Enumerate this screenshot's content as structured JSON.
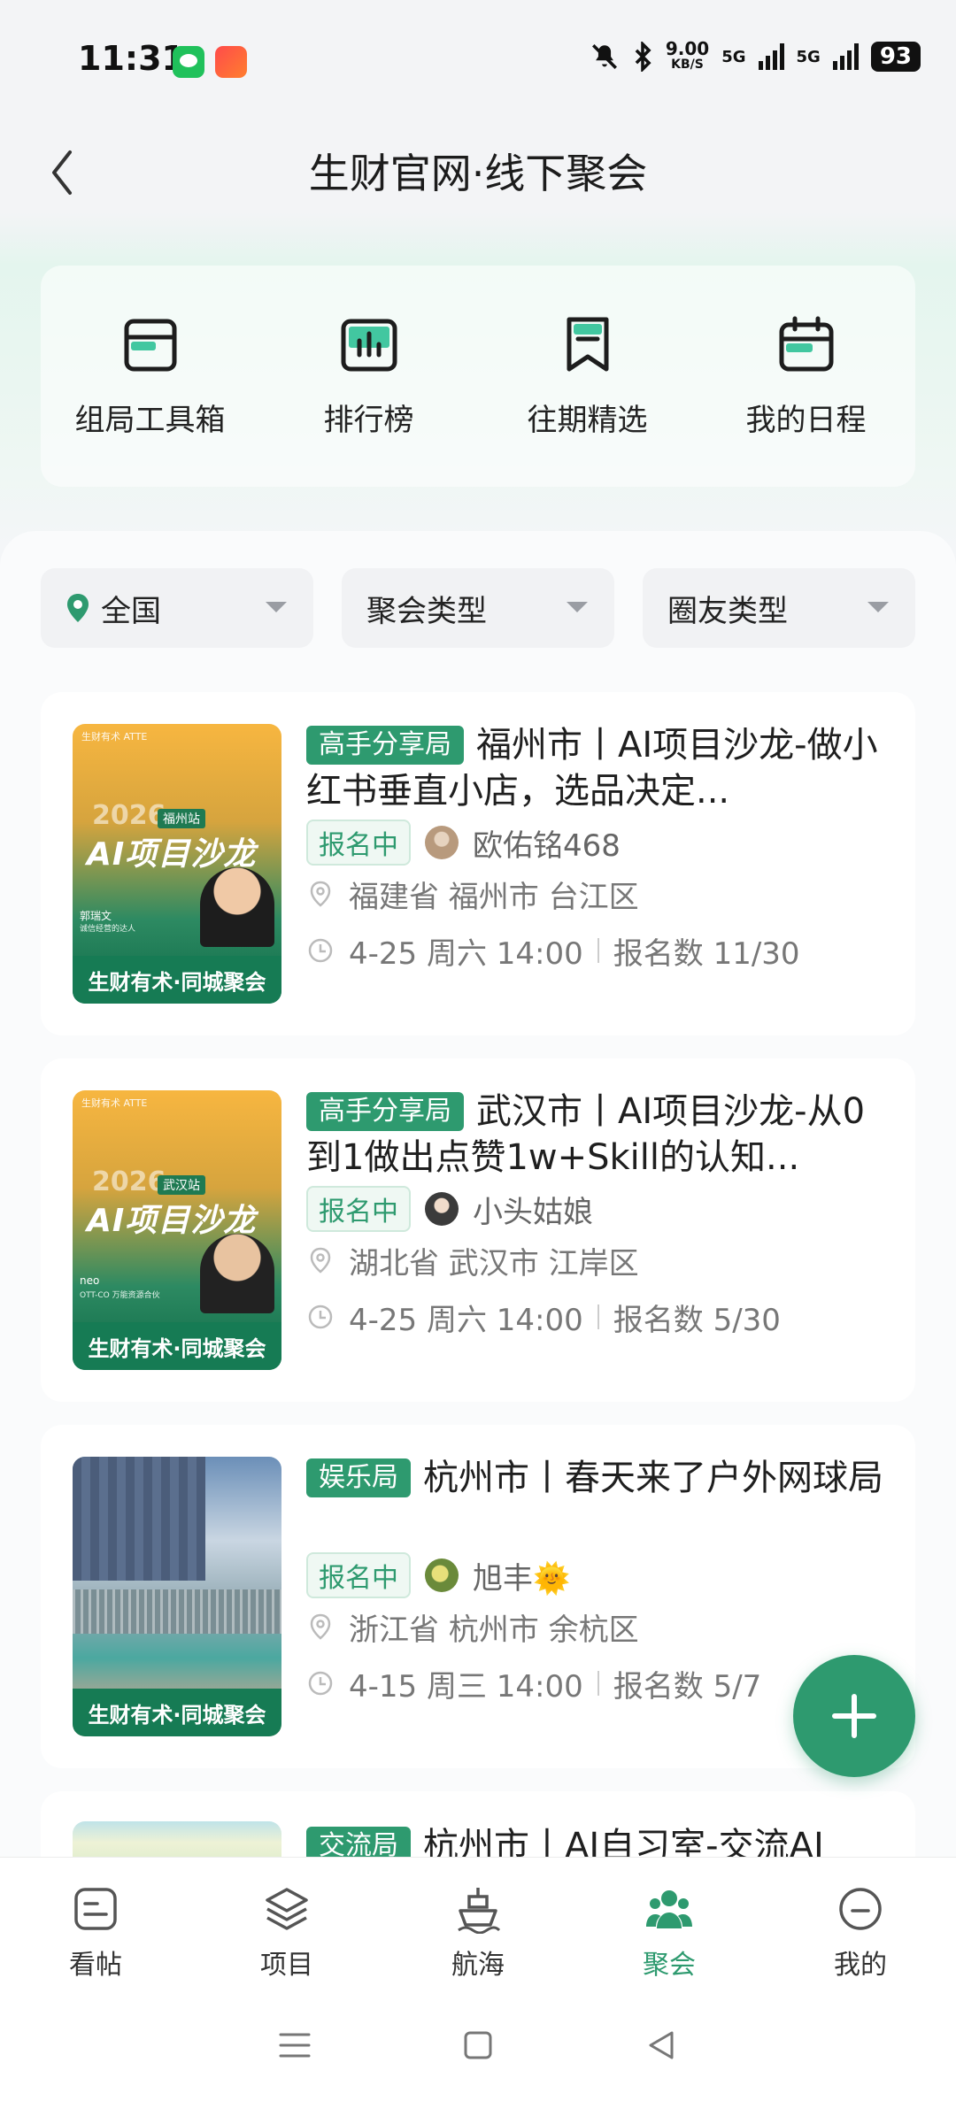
{
  "status_bar": {
    "time": "11:31",
    "net_speed_top": "9.00",
    "net_speed_bottom": "KB/S",
    "network_1": "5G",
    "network_2": "5G",
    "battery": "93"
  },
  "header": {
    "title": "生财官网·线下聚会"
  },
  "tools": [
    {
      "label": "组局工具箱",
      "icon": "toolbox-icon"
    },
    {
      "label": "排行榜",
      "icon": "ranking-icon"
    },
    {
      "label": "往期精选",
      "icon": "bookmark-icon"
    },
    {
      "label": "我的日程",
      "icon": "calendar-icon"
    }
  ],
  "filters": {
    "region": "全国",
    "meetup_type": "聚会类型",
    "member_type": "圈友类型"
  },
  "events": [
    {
      "tag": "高手分享局",
      "title": "福州市丨AI项目沙龙-做小红书垂直小店，选品决定...",
      "status": "报名中",
      "host": "欧佑铭468",
      "location": "福建省 福州市 台江区",
      "time": "4-25 周六 14:00",
      "signups": "报名数 11/30",
      "cover": {
        "brand": "生财有术 ATTE",
        "year": "2026",
        "station": "福州站",
        "headline": "AI项目沙龙",
        "speaker": "郭瑞文",
        "speaker_sub": "诚信经营的达人",
        "footer": "生财有术·同城聚会"
      }
    },
    {
      "tag": "高手分享局",
      "title": "武汉市丨AI项目沙龙-从0到1做出点赞1w+Skill的认知...",
      "status": "报名中",
      "host": "小头姑娘",
      "location": "湖北省 武汉市 江岸区",
      "time": "4-25 周六 14:00",
      "signups": "报名数 5/30",
      "cover": {
        "brand": "生财有术 ATTE",
        "year": "2026",
        "station": "武汉站",
        "headline": "AI项目沙龙",
        "speaker": "neo",
        "speaker_sub": "OTT-CO 万能资源合伙",
        "footer": "生财有术·同城聚会"
      }
    },
    {
      "tag": "娱乐局",
      "title": "杭州市丨春天来了户外网球局",
      "status": "报名中",
      "host": "旭丰🌞",
      "location": "浙江省 杭州市 余杭区",
      "time": "4-15 周三 14:00",
      "signups": "报名数 5/7",
      "cover": {
        "footer": "生财有术·同城聚会"
      }
    },
    {
      "tag": "交流局",
      "title": "杭州市丨AI自习室-交流AI"
    }
  ],
  "bottom_nav": [
    {
      "label": "看帖",
      "icon": "post-icon",
      "active": false
    },
    {
      "label": "项目",
      "icon": "layers-icon",
      "active": false
    },
    {
      "label": "航海",
      "icon": "ship-icon",
      "active": false
    },
    {
      "label": "聚会",
      "icon": "group-icon",
      "active": true
    },
    {
      "label": "我的",
      "icon": "profile-icon",
      "active": false
    }
  ],
  "colors": {
    "brand_green": "#2e9a6f",
    "dark_green": "#167b54",
    "status_chip_bg": "#eff8f3"
  }
}
